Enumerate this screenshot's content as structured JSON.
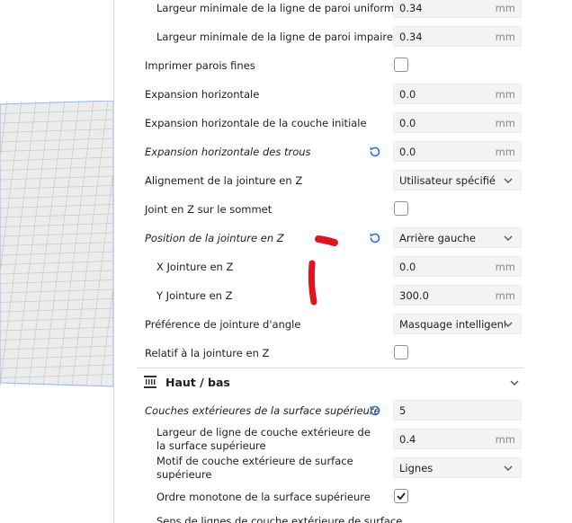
{
  "settings": [
    {
      "label": "Largeur minimale de la ligne de paroi uniforme",
      "value": "0.34",
      "unit": "mm"
    },
    {
      "label": "Largeur minimale de la ligne de paroi impaire",
      "value": "0.34",
      "unit": "mm"
    },
    {
      "label": "Imprimer parois fines"
    },
    {
      "label": "Expansion horizontale",
      "value": "0.0",
      "unit": "mm"
    },
    {
      "label": "Expansion horizontale de la couche initiale",
      "value": "0.0",
      "unit": "mm"
    },
    {
      "label": "Expansion horizontale des trous",
      "value": "0.0",
      "unit": "mm"
    },
    {
      "label": "Alignement de la jointure en Z",
      "value": "Utilisateur spécifié"
    },
    {
      "label": "Joint en Z sur le sommet"
    },
    {
      "label": "Position de la jointure en Z",
      "value": "Arrière gauche"
    },
    {
      "label": "X Jointure en Z",
      "value": "0.0",
      "unit": "mm"
    },
    {
      "label": "Y Jointure en Z",
      "value": "300.0",
      "unit": "mm"
    },
    {
      "label": "Préférence de jointure d'angle",
      "value": "Masquage intelligent"
    },
    {
      "label": "Relatif à la jointure en Z"
    },
    {
      "label": "Couches extérieures de la surface supérieure",
      "value": "5"
    },
    {
      "label": "Largeur de ligne de couche extérieure de la surface supérieure",
      "value": "0.4",
      "unit": "mm"
    },
    {
      "label": "Motif de couche extérieure de surface supérieure",
      "value": "Lignes"
    },
    {
      "label": "Ordre monotone de la surface supérieure"
    },
    {
      "label": "Sens de lignes de couche extérieure de surface"
    }
  ],
  "section": {
    "title": "Haut / bas"
  },
  "colors": {
    "plate_line": "#8ab3ff",
    "reset_icon": "#2a6fdb",
    "annotation": "#e0131e"
  },
  "icons": {
    "reset": "reset-icon",
    "chevron": "chevron-down-icon",
    "section": "top-bottom-icon"
  }
}
